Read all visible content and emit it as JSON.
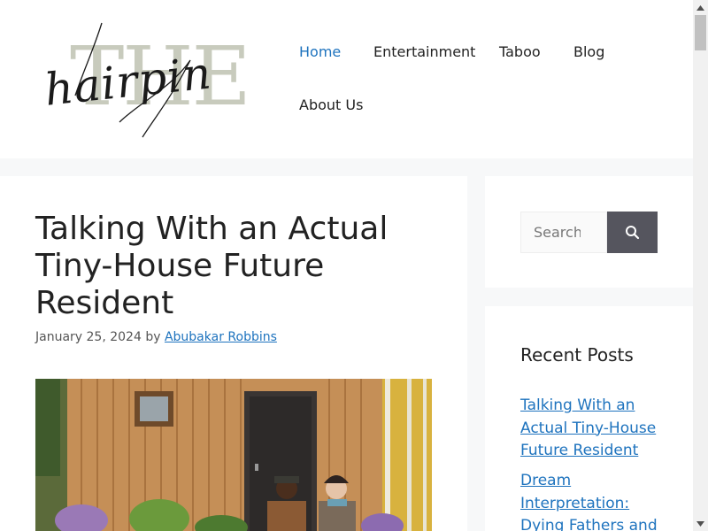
{
  "header": {
    "logo": {
      "big_text": "THE",
      "script_text": "hairpin"
    },
    "nav": [
      {
        "label": "Home",
        "active": true
      },
      {
        "label": "Entertainment",
        "active": false
      },
      {
        "label": "Taboo",
        "active": false
      },
      {
        "label": "Blog",
        "active": false
      },
      {
        "label": "About Us",
        "active": false
      }
    ]
  },
  "article": {
    "title": "Talking With an Actual Tiny-House Future Resident",
    "date": "January 25, 2024",
    "by": "by",
    "author": "Abubakar Robbins"
  },
  "sidebar": {
    "search": {
      "placeholder": "Search",
      "icon": "search-icon"
    },
    "recent": {
      "title": "Recent Posts",
      "posts": [
        "Talking With an Actual Tiny-House Future Resident",
        "Dream Interpretation: Dying Fathers and"
      ]
    }
  },
  "colors": {
    "link": "#1e73be",
    "background": "#f7f8f9",
    "search_button": "#55555e",
    "logo_grey": "#c8cbbd"
  }
}
